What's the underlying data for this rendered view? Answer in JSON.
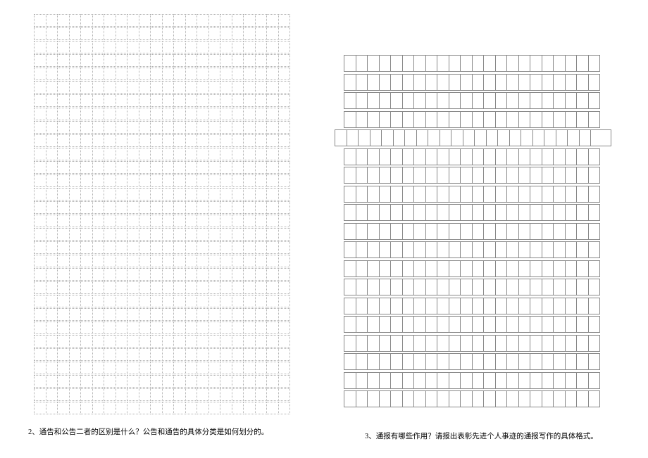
{
  "left_column": {
    "grid": {
      "rows": 30,
      "cols": 22,
      "style": "dotted"
    },
    "question": {
      "number": "2、",
      "text": "通告和公告二者的区别是什么？公告和通告的具体分类是如何划分的。"
    }
  },
  "right_column": {
    "grid": {
      "rows": 19,
      "cols": 22,
      "style": "solid",
      "wide_row_index": 4
    },
    "question": {
      "number": "3、",
      "text": "通报有哪些作用？请报出表彰先进个人事迹的通报写作的具体格式。"
    }
  }
}
